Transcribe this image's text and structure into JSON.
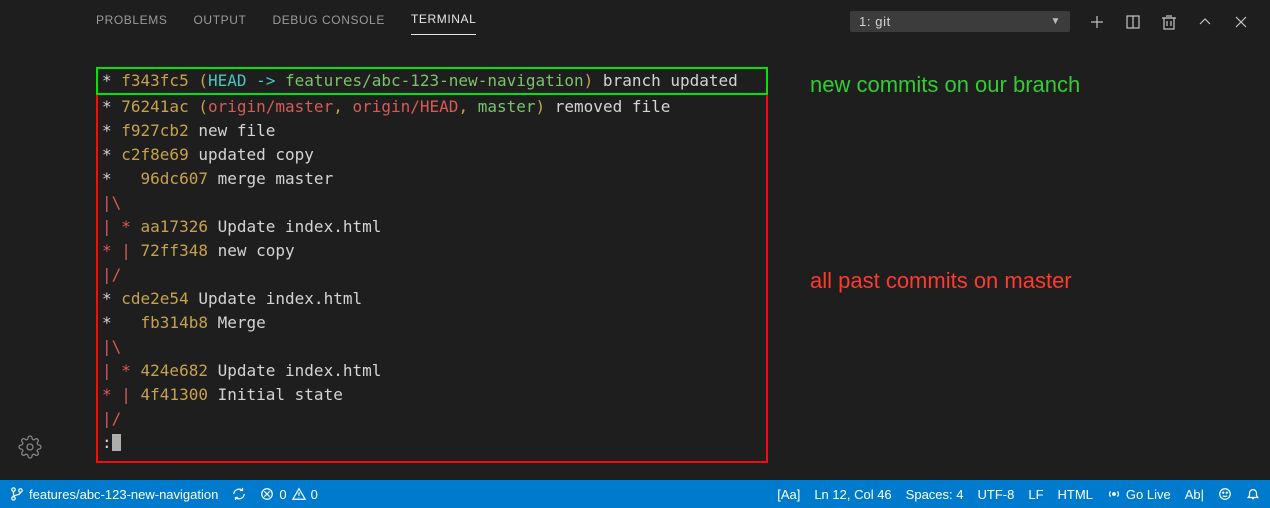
{
  "panel": {
    "tabs": [
      "PROBLEMS",
      "OUTPUT",
      "DEBUG CONSOLE",
      "TERMINAL"
    ],
    "active_tab": 3,
    "dropdown_selected": "1: git"
  },
  "annotations": {
    "new_commits": "new commits on our branch",
    "past_commits": "all past commits on master"
  },
  "log": {
    "head_line": {
      "graph": "* ",
      "hash": "f343fc5",
      "ref_open": " (",
      "head": "HEAD -> ",
      "branch": "features/abc-123-new-navigation",
      "ref_close": ")",
      "msg": " branch updated"
    },
    "lines": [
      {
        "graph": "* ",
        "hash": "76241ac",
        "ref_open": " (",
        "remote1": "origin/master",
        "sep1": ", ",
        "remote2": "origin/HEAD",
        "sep2": ", ",
        "local": "master",
        "ref_close": ")",
        "msg": " removed file"
      },
      {
        "graph": "* ",
        "hash": "f927cb2",
        "msg": " new file"
      },
      {
        "graph": "* ",
        "hash": "c2f8e69",
        "msg": " updated copy"
      },
      {
        "graph": "*   ",
        "hash": "96dc607",
        "msg": " merge master"
      },
      {
        "graph": "|\\"
      },
      {
        "graph": "| * ",
        "hash": "aa17326",
        "msg": " Update index.html"
      },
      {
        "graph": "* | ",
        "hash": "72ff348",
        "msg": " new copy"
      },
      {
        "graph": "|/"
      },
      {
        "graph": "* ",
        "hash": "cde2e54",
        "msg": " Update index.html"
      },
      {
        "graph": "*   ",
        "hash": "fb314b8",
        "msg": " Merge"
      },
      {
        "graph": "|\\"
      },
      {
        "graph": "| * ",
        "hash": "424e682",
        "msg": " Update index.html"
      },
      {
        "graph": "* | ",
        "hash": "4f41300",
        "msg": " Initial state"
      },
      {
        "graph": "|/"
      },
      {
        "graph": ":"
      }
    ]
  },
  "statusbar": {
    "branch": "features/abc-123-new-navigation",
    "errors": "0",
    "warnings": "0",
    "case": "[Aa]",
    "cursor": "Ln 12, Col 46",
    "spaces": "Spaces: 4",
    "encoding": "UTF-8",
    "eol": "LF",
    "lang": "HTML",
    "golive": "Go Live",
    "spell": "Ab|"
  }
}
